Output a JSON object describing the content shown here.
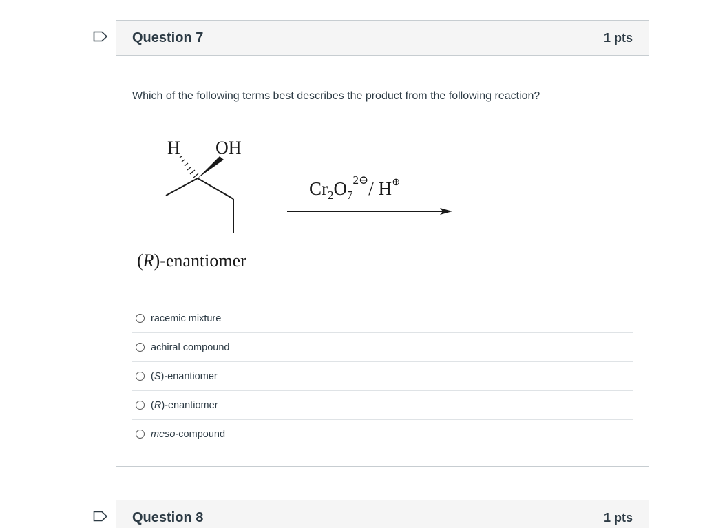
{
  "questions": [
    {
      "title": "Question 7",
      "points": "1 pts",
      "text": "Which of the following terms best describes the product from the following reaction?",
      "reaction": {
        "h_label": "H",
        "oh_label": "OH",
        "reactant_name": "(R)-enantiomer",
        "reagent": "Cr2O7 2⊖ / H⊕"
      },
      "answers": [
        {
          "pre": "",
          "italic": "",
          "post": "racemic mixture"
        },
        {
          "pre": "",
          "italic": "",
          "post": "achiral compound"
        },
        {
          "pre": "(",
          "italic": "S",
          "post": ")-enantiomer"
        },
        {
          "pre": "(",
          "italic": "R",
          "post": ")-enantiomer"
        },
        {
          "pre": "",
          "italic": "meso",
          "post": "-compound"
        }
      ]
    },
    {
      "title": "Question 8",
      "points": "1 pts"
    }
  ]
}
